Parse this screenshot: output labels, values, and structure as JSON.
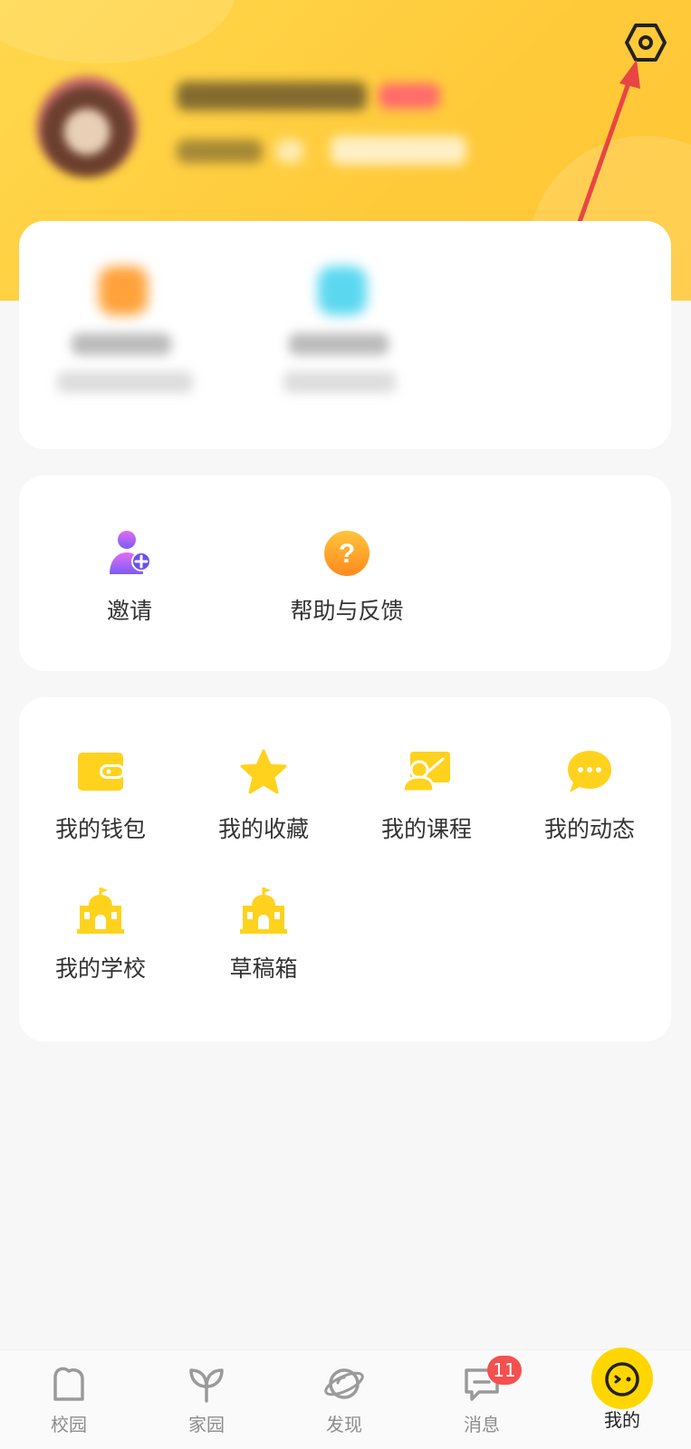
{
  "profile": {
    "settings_icon": "gear-hexagon-icon"
  },
  "quick_actions": [
    {
      "label": "邀请",
      "icon": "invite-user-icon"
    },
    {
      "label": "帮助与反馈",
      "icon": "help-question-icon"
    }
  ],
  "my_menu": [
    {
      "label": "我的钱包",
      "icon": "wallet-icon"
    },
    {
      "label": "我的收藏",
      "icon": "star-icon"
    },
    {
      "label": "我的课程",
      "icon": "course-icon"
    },
    {
      "label": "我的动态",
      "icon": "chat-bubble-icon"
    },
    {
      "label": "我的学校",
      "icon": "school-icon"
    },
    {
      "label": "草稿箱",
      "icon": "school-icon"
    }
  ],
  "tabbar": {
    "tabs": [
      {
        "label": "校园",
        "icon": "campus-icon"
      },
      {
        "label": "家园",
        "icon": "sprout-icon"
      },
      {
        "label": "发现",
        "icon": "planet-icon"
      },
      {
        "label": "消息",
        "icon": "message-icon",
        "badge": "11"
      },
      {
        "label": "我的",
        "icon": "mascot-icon",
        "active": true
      }
    ]
  },
  "colors": {
    "header": "#ffd04a",
    "accent_yellow": "#ffd21e",
    "badge_red": "#f4504f",
    "arrow_red": "#e84545"
  }
}
